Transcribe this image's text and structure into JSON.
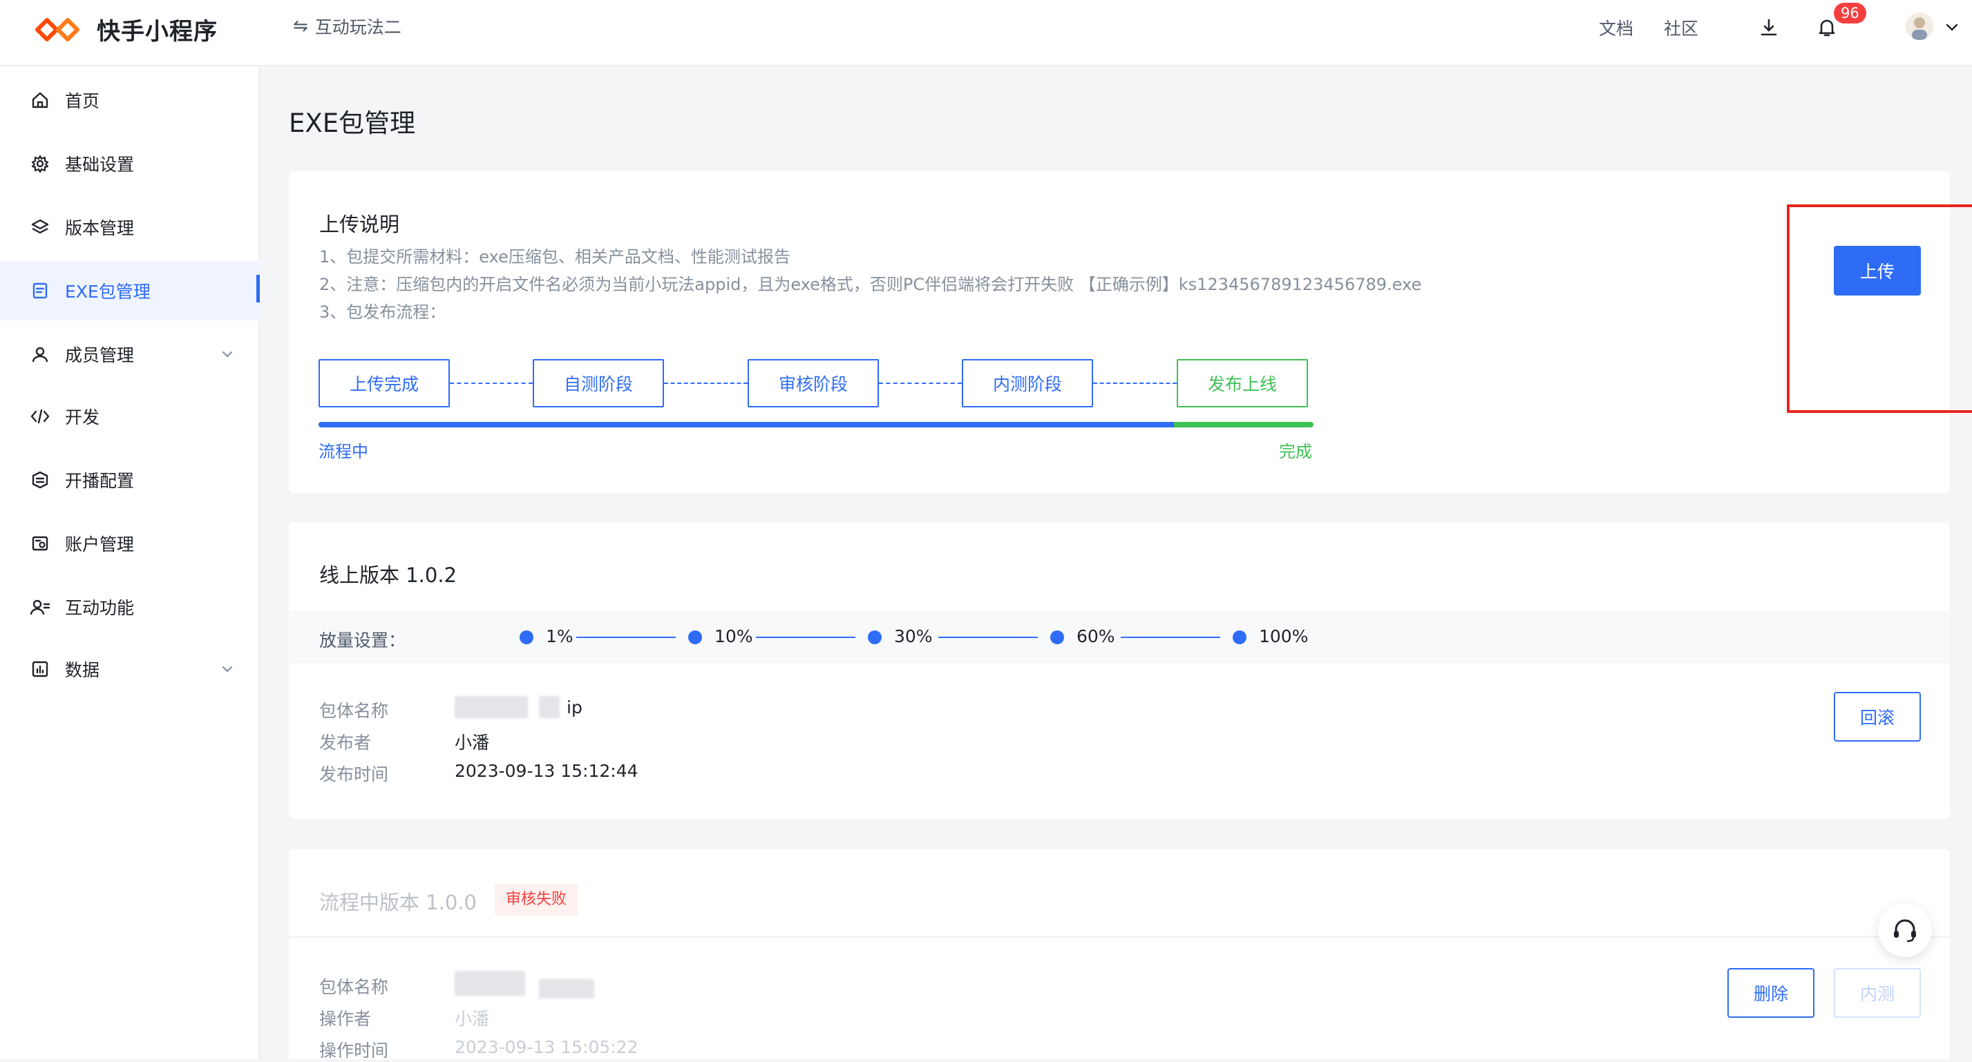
{
  "header": {
    "brand": "快手小程序",
    "project_name": "互动玩法二",
    "docs_label": "文档",
    "community_label": "社区",
    "notification_count": "96",
    "colors": {
      "primary": "#2f6cf6",
      "success": "#3ec154",
      "danger": "#f53f3f"
    }
  },
  "sidebar": {
    "items": [
      {
        "label": "首页",
        "icon": "home-icon"
      },
      {
        "label": "基础设置",
        "icon": "gear-icon"
      },
      {
        "label": "版本管理",
        "icon": "layers-icon"
      },
      {
        "label": "EXE包管理",
        "icon": "package-icon",
        "active": true
      },
      {
        "label": "成员管理",
        "icon": "user-icon",
        "expandable": true
      },
      {
        "label": "开发",
        "icon": "code-icon"
      },
      {
        "label": "开播配置",
        "icon": "broadcast-icon"
      },
      {
        "label": "账户管理",
        "icon": "account-icon"
      },
      {
        "label": "互动功能",
        "icon": "user-list-icon"
      },
      {
        "label": "数据",
        "icon": "chart-icon",
        "expandable": true
      }
    ]
  },
  "main": {
    "page_title": "EXE包管理",
    "upload_card": {
      "title": "上传说明",
      "notes": [
        "1、包提交所需材料：exe压缩包、相关产品文档、性能测试报告",
        "2、注意：压缩包内的开启文件名必须为当前小玩法appid，且为exe格式，否则PC伴侣端将会打开失败 【正确示例】ks123456789123456789.exe",
        "3、包发布流程："
      ],
      "flow_steps": [
        "上传完成",
        "自测阶段",
        "审核阶段",
        "内测阶段",
        "发布上线"
      ],
      "flow_progress_percent": 86,
      "progress_left_label": "流程中",
      "progress_right_label": "完成",
      "upload_button": "上传"
    },
    "online_card": {
      "title": "线上版本 1.0.2",
      "ramp_label": "放量设置：",
      "ramp_steps": [
        "1%",
        "10%",
        "30%",
        "60%",
        "100%"
      ],
      "fields": [
        {
          "label": "包体名称",
          "value": "ip"
        },
        {
          "label": "发布者",
          "value": "小潘"
        },
        {
          "label": "发布时间",
          "value": "2023-09-13 15:12:44"
        }
      ],
      "rollback_button": "回滚"
    },
    "pending_card": {
      "title": "流程中版本 1.0.0",
      "status": "审核失败",
      "fields": [
        {
          "label": "包体名称",
          "value": ""
        },
        {
          "label": "操作者",
          "value": "小潘"
        },
        {
          "label": "操作时间",
          "value": "2023-09-13 15:05:22"
        }
      ],
      "delete_button": "删除",
      "beta_button": "内测"
    }
  }
}
